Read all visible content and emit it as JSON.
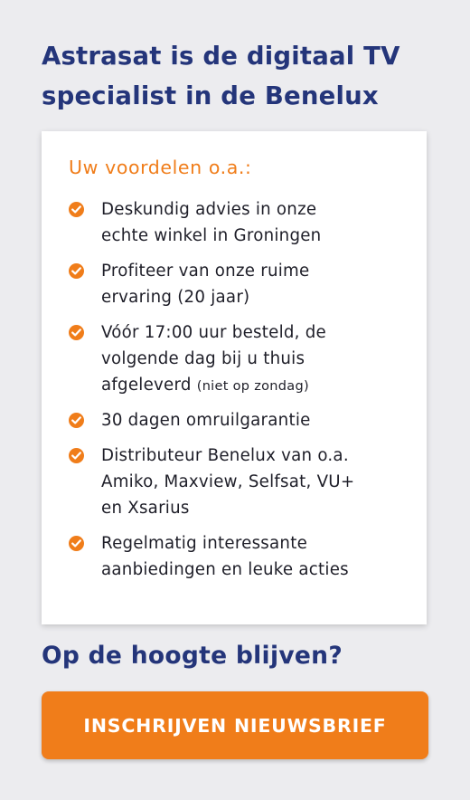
{
  "headline": {
    "line1": "Astrasat is de digitaal TV",
    "line2": "specialist in de Benelux"
  },
  "card": {
    "title": "Uw voordelen o.a.:",
    "benefits": [
      {
        "lines": [
          "Deskundig advies in onze",
          "echte winkel in Groningen"
        ]
      },
      {
        "lines": [
          "Profiteer van onze ruime",
          "ervaring (20 jaar)"
        ]
      },
      {
        "lines": [
          "Vóór 17:00 uur besteld, de",
          "volgende dag bij u thuis",
          "afgeleverd"
        ],
        "note": "(niet op zondag)"
      },
      {
        "lines": [
          "30 dagen omruilgarantie"
        ]
      },
      {
        "lines": [
          "Distributeur Benelux van o.a.",
          "Amiko, Maxview, Selfsat, VU+",
          "en Xsarius"
        ]
      },
      {
        "lines": [
          "Regelmatig interessante",
          "aanbiedingen en leuke acties"
        ]
      }
    ]
  },
  "subhead": "Op de hoogte blijven?",
  "cta_label": "INSCHRIJVEN NIEUWSBRIEF",
  "icons": {
    "benefit_bullet": "check-circle-icon"
  },
  "colors": {
    "navy": "#24357a",
    "orange": "#f07d1a",
    "text": "#1e1e28",
    "background": "#ececef",
    "card": "#ffffff"
  }
}
